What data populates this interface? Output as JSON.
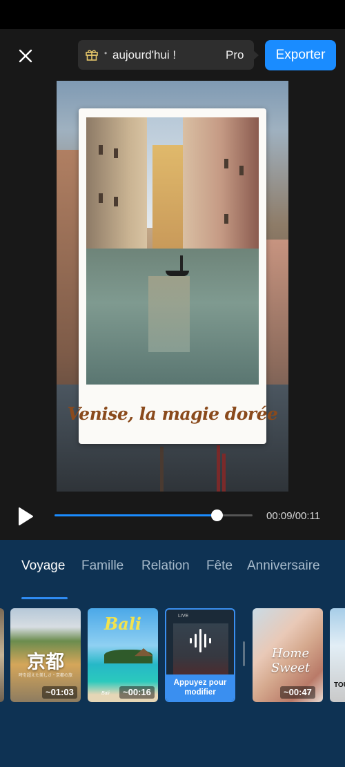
{
  "header": {
    "promo_text": "aujourd'hui !",
    "promo_text_2": "Pro",
    "promo_dot": "•",
    "export_label": "Exporter"
  },
  "preview": {
    "caption": "Venise, la magie dorée"
  },
  "player": {
    "time": "00:09/00:11",
    "progress_fraction": 0.818
  },
  "categories": {
    "tabs": [
      "Voyage",
      "Famille",
      "Relation",
      "Fête",
      "Anniversaire"
    ],
    "active_index": 0
  },
  "templates": [
    {
      "overlay": "京都",
      "subtitle": "時を超えた美しさ・京都の旅",
      "duration": "~01:03"
    },
    {
      "overlay": "Bali",
      "subtitle": "Bali",
      "duration": "~00:16"
    },
    {
      "overlay": "LIVE",
      "action_label": "Appuyez pour modifier"
    },
    {
      "overlay": "Home Sweet",
      "duration": "~00:47"
    },
    {
      "overlay": "TOU"
    }
  ],
  "colors": {
    "accent": "#1a8cff",
    "panel": "#0e3253",
    "caption": "#8a4a1c"
  }
}
